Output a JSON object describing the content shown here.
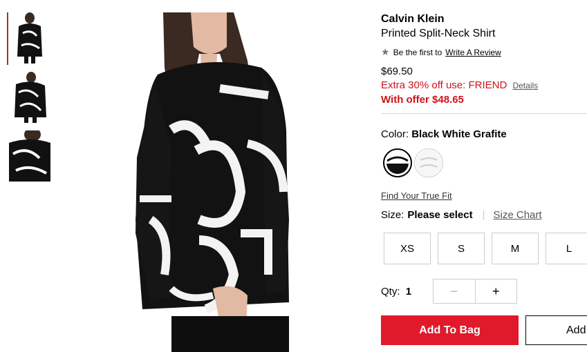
{
  "product": {
    "brand": "Calvin Klein",
    "name": "Printed Split-Neck Shirt",
    "review_prefix": "Be the first to",
    "review_link": "Write A Review",
    "price": "$69.50",
    "promo_text": "Extra 30% off use: FRIEND",
    "promo_details": "Details",
    "offer_text": "With offer $48.65"
  },
  "color": {
    "label": "Color:",
    "selected": "Black White Grafite",
    "swatches": [
      "black-white-swatch",
      "white-print-swatch"
    ]
  },
  "fit": {
    "link": "Find Your True Fit"
  },
  "size": {
    "label": "Size:",
    "selected": "Please select",
    "chart_link": "Size Chart",
    "options": [
      "XS",
      "S",
      "M",
      "L"
    ]
  },
  "qty": {
    "label": "Qty:",
    "value": "1",
    "minus": "−",
    "plus": "+"
  },
  "actions": {
    "add_to_bag": "Add To Bag",
    "add_to_list": "Add"
  },
  "colors": {
    "accent_red": "#e11a2b",
    "promo_red": "#d0121b"
  }
}
